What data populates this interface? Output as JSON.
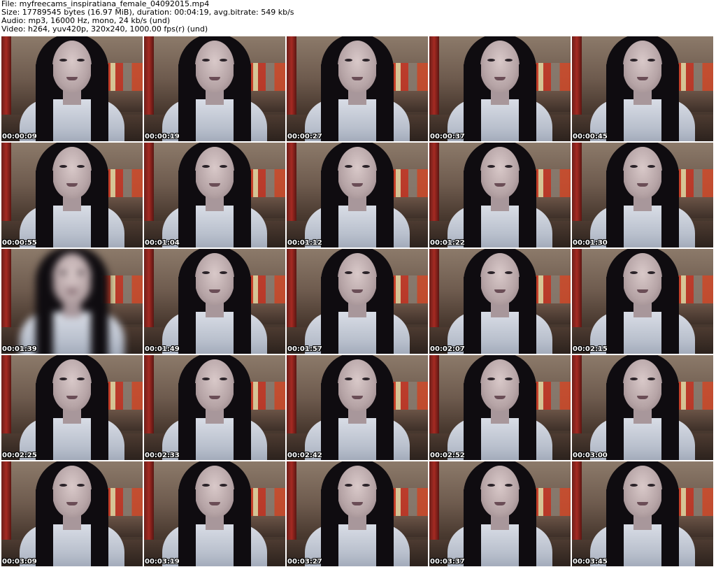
{
  "header": {
    "file_line": "File: myfreecams_inspiratiana_female_04092015.mp4",
    "size_line": "Size: 17789545 bytes (16.97 MiB), duration: 00:04:19, avg.bitrate: 549 kb/s",
    "audio_line": "Audio: mp3, 16000 Hz, mono, 24 kb/s (und)",
    "video_line": "Video: h264, yuv420p, 320x240, 1000.00 fps(r) (und)"
  },
  "thumbnails": [
    {
      "timestamp": "00:00:09"
    },
    {
      "timestamp": "00:00:19"
    },
    {
      "timestamp": "00:00:27"
    },
    {
      "timestamp": "00:00:37"
    },
    {
      "timestamp": "00:00:45"
    },
    {
      "timestamp": "00:00:55"
    },
    {
      "timestamp": "00:01:04"
    },
    {
      "timestamp": "00:01:12"
    },
    {
      "timestamp": "00:01:22"
    },
    {
      "timestamp": "00:01:30"
    },
    {
      "timestamp": "00:01:39"
    },
    {
      "timestamp": "00:01:49"
    },
    {
      "timestamp": "00:01:57"
    },
    {
      "timestamp": "00:02:07"
    },
    {
      "timestamp": "00:02:15"
    },
    {
      "timestamp": "00:02:25"
    },
    {
      "timestamp": "00:02:33"
    },
    {
      "timestamp": "00:02:42"
    },
    {
      "timestamp": "00:02:52"
    },
    {
      "timestamp": "00:03:00"
    },
    {
      "timestamp": "00:03:09"
    },
    {
      "timestamp": "00:03:19"
    },
    {
      "timestamp": "00:03:27"
    },
    {
      "timestamp": "00:03:37"
    },
    {
      "timestamp": "00:03:45"
    }
  ]
}
